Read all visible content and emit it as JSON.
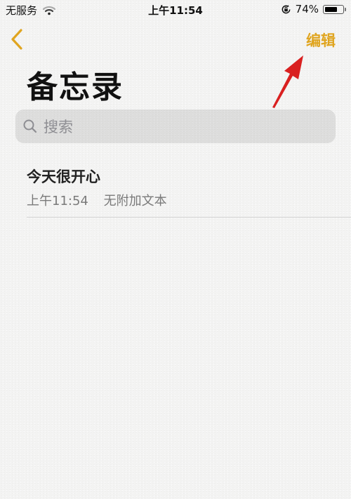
{
  "status_bar": {
    "carrier": "无服务",
    "time": "上午11:54",
    "battery_percent_label": "74%",
    "battery_level": 0.74
  },
  "nav": {
    "edit_label": "编辑"
  },
  "page_title": "备忘录",
  "search": {
    "placeholder": "搜索"
  },
  "notes": [
    {
      "title": "今天很开心",
      "time": "上午11:54",
      "preview": "无附加文本"
    }
  ],
  "colors": {
    "accent": "#e0a520",
    "annotation_arrow": "#d92020"
  }
}
